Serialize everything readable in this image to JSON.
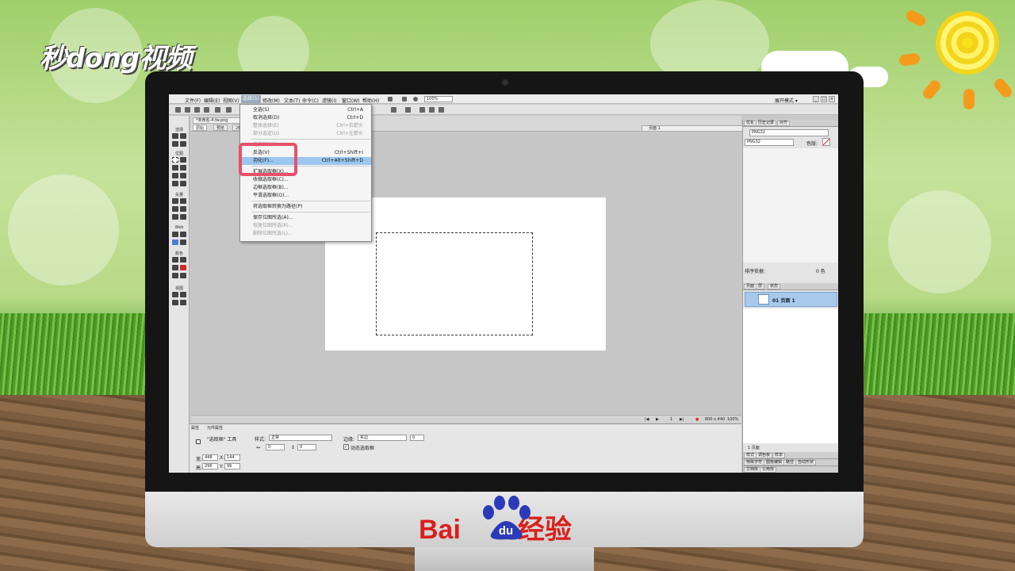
{
  "watermark": {
    "logo_text": "秒dong视频",
    "brand": "Bai",
    "brand_paw": "du",
    "brand_suffix": "经验"
  },
  "menubar": {
    "items": [
      "文件(F)",
      "编辑(E)",
      "视图(V)",
      "选择(S)",
      "修改(M)",
      "文本(T)",
      "命令(C)",
      "滤镜(I)",
      "窗口(W)",
      "帮助(H)"
    ],
    "zoom": "100%",
    "workmode": "展开模式 ▾",
    "window_buttons": [
      "_",
      "□",
      "×"
    ]
  },
  "doc": {
    "tab": "*未命名-4.fw.png",
    "views": [
      "原始",
      "预览",
      "2幅"
    ],
    "page": "页面 1"
  },
  "tools": {
    "sections": [
      "选择",
      "位图",
      "矢量",
      "Web",
      "颜色",
      "视图"
    ]
  },
  "select_menu": {
    "items": [
      {
        "label": "全选(S)",
        "shortcut": "Ctrl+A",
        "disabled": false
      },
      {
        "label": "取消选择(D)",
        "shortcut": "Ctrl+D",
        "disabled": false
      },
      {
        "label": "整体选择(E)",
        "shortcut": "Ctrl+右箭头",
        "disabled": true
      },
      {
        "label": "部分选定(U)",
        "shortcut": "Ctrl+左箭头",
        "disabled": true
      },
      {
        "label": "选择相似(I)",
        "shortcut": "",
        "disabled": true
      },
      {
        "label": "反选(V)",
        "shortcut": "Ctrl+Shift+I",
        "disabled": false
      },
      {
        "label": "羽化(F)...",
        "shortcut": "Ctrl+Alt+Shift+D",
        "disabled": false,
        "highlighted": true
      },
      {
        "label": "扩展选取框(X)...",
        "shortcut": "",
        "disabled": false
      },
      {
        "label": "收缩选取框(C)...",
        "shortcut": "",
        "disabled": false
      },
      {
        "label": "边框选取框(B)...",
        "shortcut": "",
        "disabled": false
      },
      {
        "label": "平滑选取框(O)...",
        "shortcut": "",
        "disabled": false
      },
      {
        "label": "将选取框转换为路径(P)",
        "shortcut": "",
        "disabled": false
      },
      {
        "label": "保存位图所选(A)...",
        "shortcut": "",
        "disabled": false
      },
      {
        "label": "恢复位图所选(R)...",
        "shortcut": "",
        "disabled": true
      },
      {
        "label": "删除位图所选(L)...",
        "shortcut": "",
        "disabled": true
      }
    ]
  },
  "status": {
    "page_num": "1",
    "size": "800 x 440",
    "zoom": "100%"
  },
  "properties": {
    "tabs": [
      "属性",
      "元件属性"
    ],
    "tool_name": "\"选取框\" 工具",
    "style_label": "样式:",
    "style_value": "正常",
    "edge_label": "边缘:",
    "edge_value": "实边",
    "edge_amount": "0",
    "ratio_w": "0",
    "ratio_h": "0",
    "live_marquee": "动态选取框",
    "w_label": "宽:",
    "w_value": "448",
    "h_label": "高:",
    "h_value": "296",
    "x_label": "X:",
    "x_value": "144",
    "y_label": "Y:",
    "y_value": "99"
  },
  "right_panel": {
    "top_tabs": [
      "优化",
      "历史记录",
      "对齐"
    ],
    "format1": "PNG32",
    "format2": "PNG32",
    "matte_label": "色版:",
    "sort_label": "排序依据:",
    "colors_count": "0 色",
    "layer_tabs": [
      "页面",
      "层",
      "状态"
    ],
    "page_row": "01 页面 1",
    "pages_footer": "1 页面",
    "bottom_tabs1": [
      "样式",
      "调色板",
      "样本"
    ],
    "bottom_tabs2": [
      "特殊字符",
      "图像编辑",
      "路径",
      "自动形状"
    ],
    "bottom_tabs3": [
      "文档库",
      "公用库"
    ]
  }
}
